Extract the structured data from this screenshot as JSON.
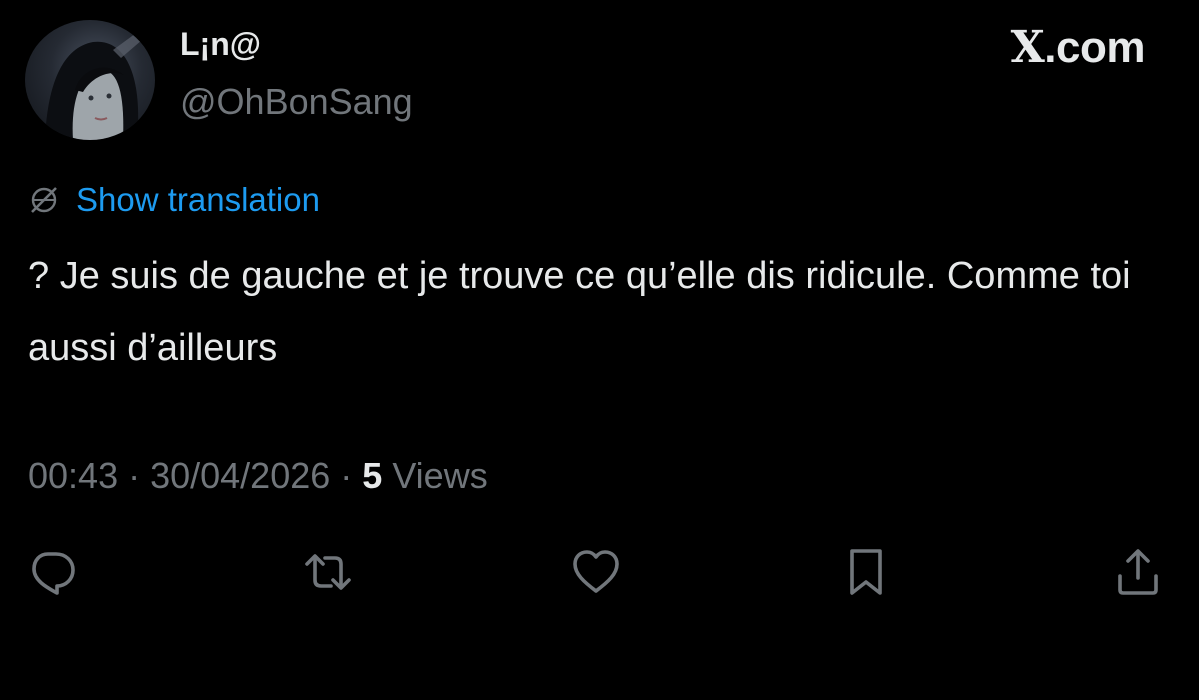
{
  "author": {
    "display_name": "L¡n@",
    "handle": "@OhBonSang"
  },
  "brand": {
    "x_letter": "X",
    "domain_suffix": ".com"
  },
  "translation": {
    "icon": "globe-slash-icon",
    "label": "Show translation"
  },
  "tweet": {
    "text": "? Je suis de gauche et je trouve ce qu’elle dis ridicule. Comme toi aussi d’ailleurs"
  },
  "meta": {
    "time": "00:43",
    "separator": " · ",
    "date": "30/04/2026",
    "views_count": "5",
    "views_label": " Views"
  },
  "actions": [
    {
      "icon": "reply-icon"
    },
    {
      "icon": "retweet-icon"
    },
    {
      "icon": "like-heart-icon"
    },
    {
      "icon": "bookmark-icon"
    },
    {
      "icon": "share-icon"
    }
  ],
  "colors": {
    "background": "#000000",
    "text_primary": "#e7e9ea",
    "text_secondary": "#71767b",
    "accent": "#1d9bf0"
  }
}
